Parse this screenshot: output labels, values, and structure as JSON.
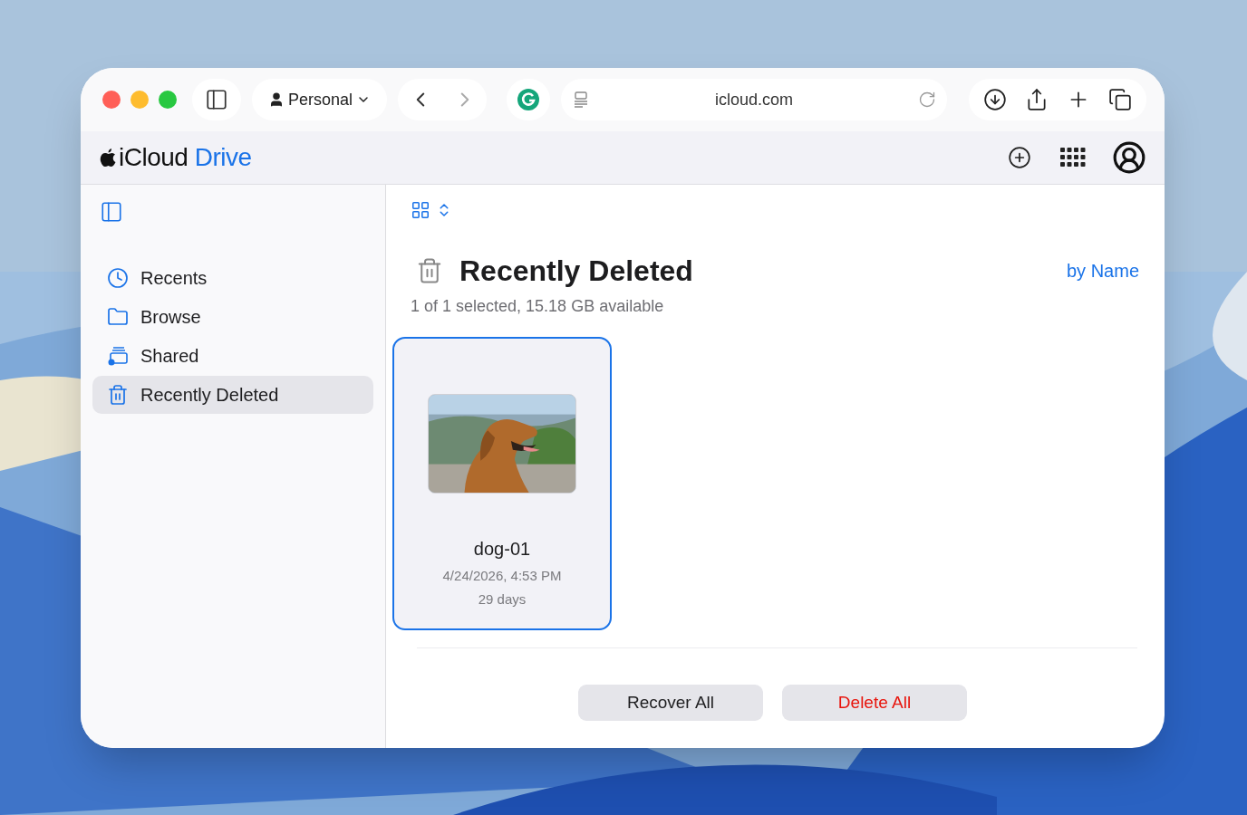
{
  "browser": {
    "profile": "Personal",
    "address": "icloud.com"
  },
  "app": {
    "brand": "iCloud",
    "product": "Drive"
  },
  "sidebar": {
    "items": [
      {
        "label": "Recents",
        "kind": "recents",
        "selected": false
      },
      {
        "label": "Browse",
        "kind": "browse",
        "selected": false
      },
      {
        "label": "Shared",
        "kind": "shared",
        "selected": false
      },
      {
        "label": "Recently Deleted",
        "kind": "trash",
        "selected": true
      }
    ]
  },
  "content": {
    "title": "Recently Deleted",
    "summary": "1 of 1 selected, 15.18 GB available",
    "sort": "by Name",
    "files": [
      {
        "name": "dog-01",
        "date": "4/24/2026, 4:53 PM",
        "remaining": "29 days",
        "selected": true,
        "kind": "picture"
      }
    ],
    "buttons": [
      {
        "label": "Recover All",
        "kind": "normal"
      },
      {
        "label": "Delete All",
        "kind": "destructive"
      }
    ]
  }
}
